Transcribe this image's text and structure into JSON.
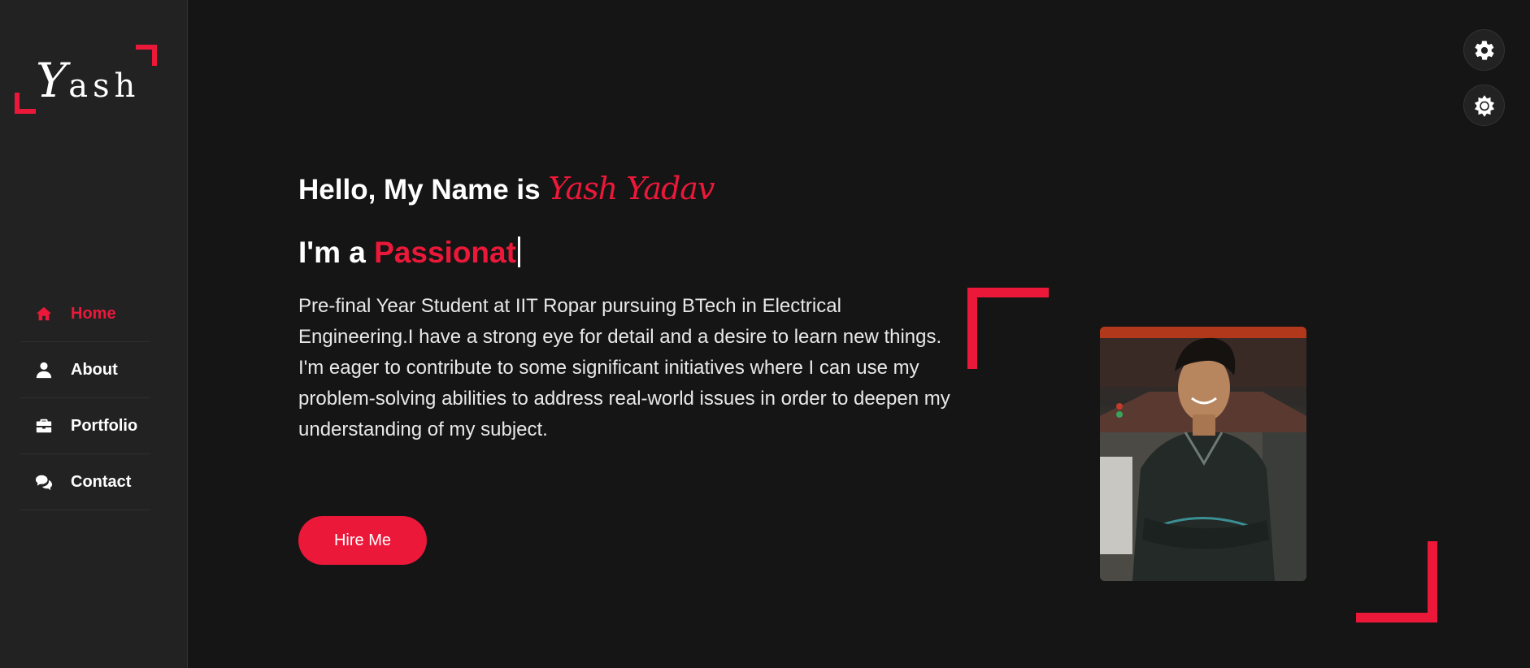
{
  "logo": {
    "initial": "Y",
    "rest": "ash"
  },
  "nav": {
    "items": [
      {
        "label": "Home",
        "icon": "home-icon",
        "active": true
      },
      {
        "label": "About",
        "icon": "user-icon",
        "active": false
      },
      {
        "label": "Portfolio",
        "icon": "briefcase-icon",
        "active": false
      },
      {
        "label": "Contact",
        "icon": "chat-icon",
        "active": false
      }
    ]
  },
  "hero": {
    "greeting": "Hello, My Name is",
    "name": "Yash Yadav",
    "role_prefix": "I'm a",
    "role_typed": "Passionat",
    "about": "Pre-final Year Student at IIT Ropar pursuing BTech in Electrical Engineering.I have a strong eye for detail and a desire to learn new things. I'm eager to contribute to some significant initiatives where I can use my problem-solving abilities to address real-world issues in order to deepen my understanding of my subject.",
    "cta": "Hire Me"
  },
  "colors": {
    "accent": "#ec1839",
    "background": "#151515",
    "sidebar": "#222222"
  },
  "toolbar": {
    "style_switcher_icon": "gear-icon",
    "day_night_icon": "sun-icon"
  }
}
